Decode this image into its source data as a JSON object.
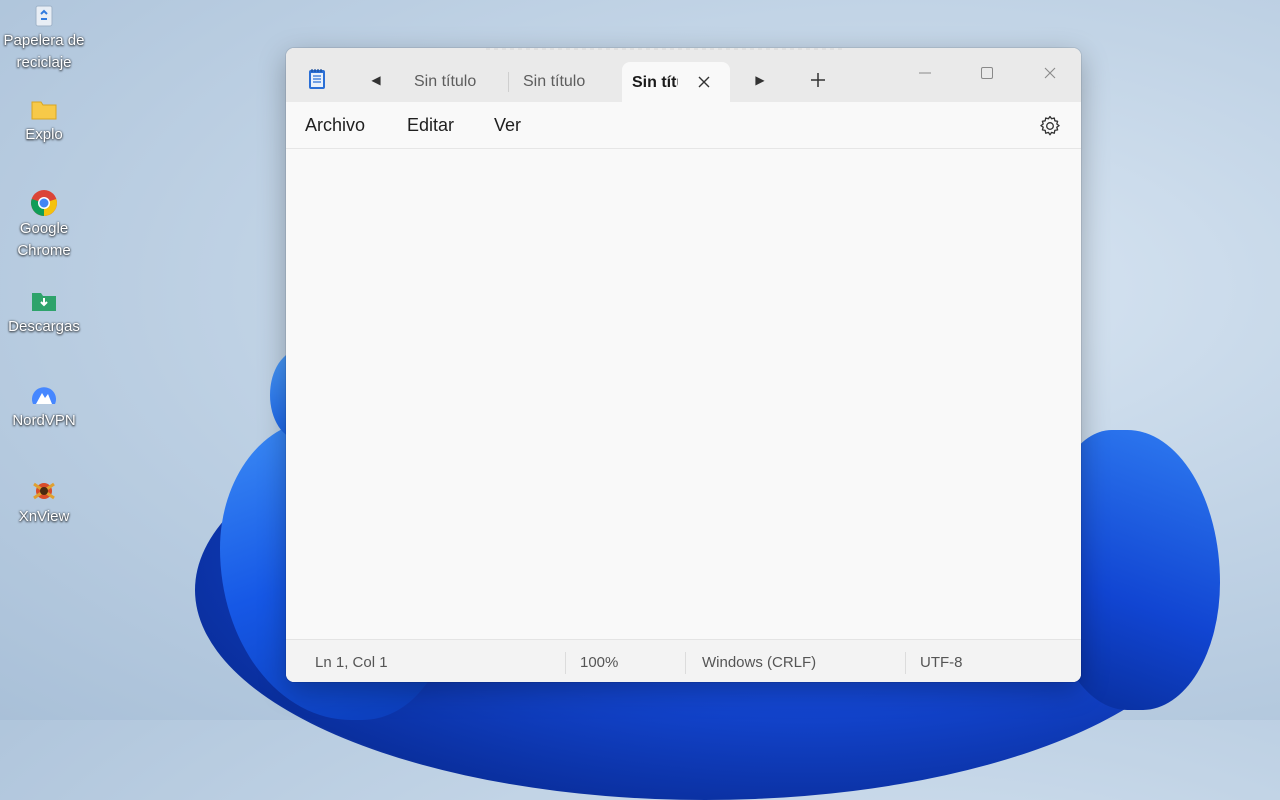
{
  "desktop": {
    "icons": [
      {
        "name": "recycle-bin-icon",
        "label": "Papelera de reciclaje"
      },
      {
        "name": "folder-icon",
        "label": "Explo"
      },
      {
        "name": "chrome-icon",
        "label": "Google Chrome"
      },
      {
        "name": "downloads-folder-icon",
        "label": "Descargas"
      },
      {
        "name": "nordvpn-icon",
        "label": "NordVPN"
      },
      {
        "name": "xnview-icon",
        "label": "XnView"
      }
    ]
  },
  "notepad": {
    "tabs": [
      {
        "label": "Sin título"
      },
      {
        "label": "Sin título"
      },
      {
        "label": "Sin título",
        "active": true
      }
    ],
    "menu": {
      "file": "Archivo",
      "edit": "Editar",
      "view": "Ver"
    },
    "status": {
      "position": "Ln 1, Col 1",
      "zoom": "100%",
      "line_endings": "Windows (CRLF)",
      "encoding": "UTF-8"
    },
    "colors": {
      "titlebar": "#eaeaea",
      "window": "#f9f9f9",
      "statusbar": "#f3f3f3"
    }
  }
}
